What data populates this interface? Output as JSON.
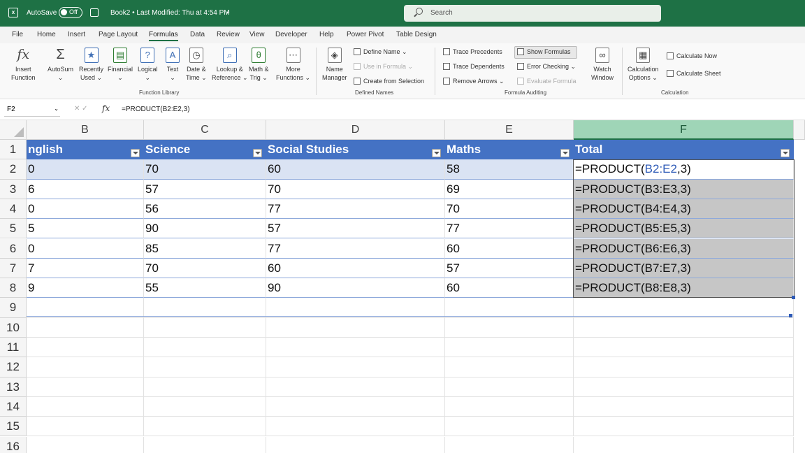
{
  "titlebar": {
    "app_logo": "excel-logo",
    "autosave_label": "AutoSave",
    "autosave_state": "Off",
    "doc_title": "Book2 • Last Modified: Thu at 4:54 PM",
    "search_placeholder": "Search"
  },
  "menu": {
    "tabs": [
      "File",
      "Home",
      "Insert",
      "Page Layout",
      "Formulas",
      "Data",
      "Review",
      "View",
      "Developer",
      "Help",
      "Power Pivot",
      "Table Design"
    ],
    "active": "Formulas"
  },
  "ribbon": {
    "function_library": {
      "label": "Function Library",
      "insert_function": [
        "Insert",
        "Function"
      ],
      "autosum": [
        "AutoSum",
        "⌄"
      ],
      "recently_used": [
        "Recently",
        "Used ⌄"
      ],
      "financial": [
        "Financial",
        "⌄"
      ],
      "logical": [
        "Logical",
        "⌄"
      ],
      "text": [
        "Text",
        "⌄"
      ],
      "date_time": [
        "Date &",
        "Time ⌄"
      ],
      "lookup_reference": [
        "Lookup &",
        "Reference ⌄"
      ],
      "math_trig": [
        "Math &",
        "Trig ⌄"
      ],
      "more_functions": [
        "More",
        "Functions ⌄"
      ]
    },
    "defined_names": {
      "label": "Defined Names",
      "name_manager": [
        "Name",
        "Manager"
      ],
      "define_name": "Define Name ⌄",
      "use_in_formula": "Use in Formula ⌄",
      "create_from_selection": "Create from Selection"
    },
    "formula_auditing": {
      "label": "Formula Auditing",
      "trace_precedents": "Trace Precedents",
      "trace_dependents": "Trace Dependents",
      "remove_arrows": "Remove Arrows ⌄",
      "show_formulas": "Show Formulas",
      "error_checking": "Error Checking ⌄",
      "evaluate_formula": "Evaluate Formula",
      "watch_window": [
        "Watch",
        "Window"
      ]
    },
    "calculation": {
      "label": "Calculation",
      "calculation_options": [
        "Calculation",
        "Options ⌄"
      ],
      "calculate_now": "Calculate Now",
      "calculate_sheet": "Calculate Sheet"
    }
  },
  "formula_bar": {
    "name_box": "F2",
    "formula": "=PRODUCT(B2:E2,3)"
  },
  "grid": {
    "columns": [
      "B",
      "C",
      "D",
      "E",
      "F"
    ],
    "rows": [
      "1",
      "2",
      "3",
      "4",
      "5",
      "6",
      "7",
      "8",
      "9",
      "10",
      "11",
      "12",
      "13",
      "14",
      "15",
      "16"
    ],
    "headers": [
      "nglish",
      "Science",
      "Social Studies",
      "Maths",
      "Total"
    ],
    "data": [
      [
        "0",
        "70",
        "60",
        "58"
      ],
      [
        "6",
        "57",
        "70",
        "69"
      ],
      [
        "0",
        "56",
        "77",
        "70"
      ],
      [
        "5",
        "90",
        "57",
        "77"
      ],
      [
        "0",
        "85",
        "77",
        "60"
      ],
      [
        "7",
        "70",
        "60",
        "57"
      ],
      [
        "9",
        "55",
        "90",
        "60"
      ]
    ],
    "formulas": [
      {
        "prefix": "=PRODUCT(",
        "ref": "B2:E2",
        "suffix": ",3)"
      },
      {
        "prefix": "=PRODUCT(",
        "ref": "B3:E3",
        "suffix": ",3)"
      },
      {
        "prefix": "=PRODUCT(",
        "ref": "B4:E4",
        "suffix": ",3)"
      },
      {
        "prefix": "=PRODUCT(",
        "ref": "B5:E5",
        "suffix": ",3)"
      },
      {
        "prefix": "=PRODUCT(",
        "ref": "B6:E6",
        "suffix": ",3)"
      },
      {
        "prefix": "=PRODUCT(",
        "ref": "B7:E7",
        "suffix": ",3)"
      },
      {
        "prefix": "=PRODUCT(",
        "ref": "B8:E8",
        "suffix": ",3)"
      }
    ],
    "active_cell": "F2",
    "colors": {
      "table_header": "#4472c4",
      "band": "#dae3f3",
      "selection": "#c6c6c6",
      "accent": "#1e7145"
    }
  }
}
